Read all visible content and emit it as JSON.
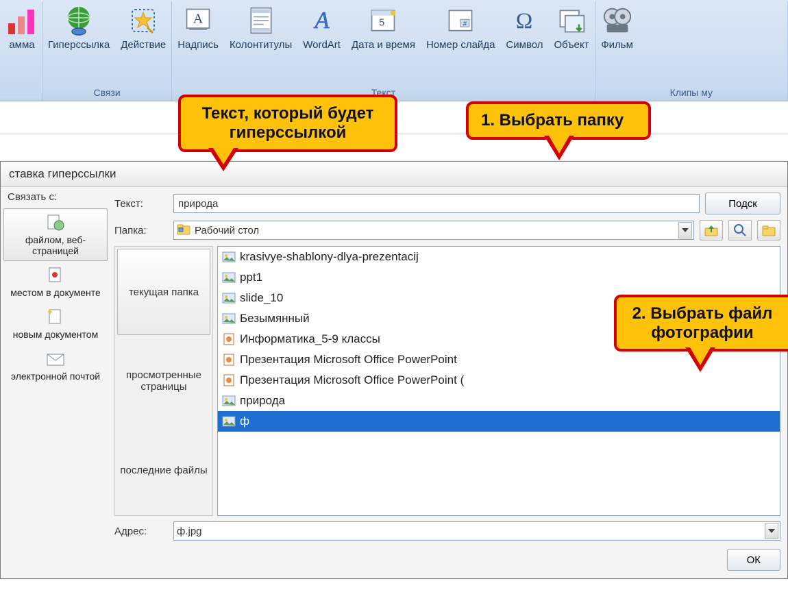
{
  "ribbon": {
    "groups": [
      {
        "label": "",
        "items": [
          {
            "label": "амма",
            "icon": "chart"
          }
        ]
      },
      {
        "label": "Связи",
        "items": [
          {
            "label": "Гиперссылка",
            "icon": "globe-link"
          },
          {
            "label": "Действие",
            "icon": "star-action"
          }
        ]
      },
      {
        "label": "Текст",
        "items": [
          {
            "label": "Надпись",
            "icon": "textbox-a"
          },
          {
            "label": "Колонтитулы",
            "icon": "header-footer"
          },
          {
            "label": "WordArt",
            "icon": "wordart-a"
          },
          {
            "label": "Дата и время",
            "icon": "date-time"
          },
          {
            "label": "Номер слайда",
            "icon": "slide-number"
          },
          {
            "label": "Символ",
            "icon": "omega"
          },
          {
            "label": "Объект",
            "icon": "object"
          }
        ]
      },
      {
        "label": "Клипы му",
        "items": [
          {
            "label": "Фильм",
            "icon": "film"
          }
        ]
      }
    ]
  },
  "dialog": {
    "title": "ставка гиперссылки",
    "link_to_label": "Связать с:",
    "text_label": "Текст:",
    "text_value": "природа",
    "folder_label": "Папка:",
    "folder_value": "Рабочий стол",
    "address_label": "Адрес:",
    "address_value": "ф.jpg",
    "hint_button": "Подск",
    "ok_button": "ОК",
    "left_items": [
      {
        "label": "файлом, веб-страницей",
        "icon": "file-web",
        "selected": true
      },
      {
        "label": "местом в документе",
        "icon": "place-doc",
        "selected": false
      },
      {
        "label": "новым документом",
        "icon": "new-doc",
        "selected": false
      },
      {
        "label": "электронной почтой",
        "icon": "email",
        "selected": false
      }
    ],
    "mid_tabs": [
      {
        "label": "текущая папка",
        "selected": true
      },
      {
        "label": "просмотрен­ные страницы",
        "selected": false
      },
      {
        "label": "последние файлы",
        "selected": false
      }
    ],
    "files": [
      {
        "name": "krasivye-shablony-dlya-prezentacij",
        "icon": "image",
        "selected": false
      },
      {
        "name": "ppt1",
        "icon": "image",
        "selected": false
      },
      {
        "name": "slide_10",
        "icon": "image",
        "selected": false
      },
      {
        "name": "Безымянный",
        "icon": "image",
        "selected": false
      },
      {
        "name": "Информатика_5-9 классы",
        "icon": "ppt",
        "selected": false
      },
      {
        "name": "Презентация Microsoft Office PowerPoint",
        "icon": "ppt",
        "selected": false
      },
      {
        "name": "Презентация Microsoft Office PowerPoint (",
        "icon": "ppt",
        "selected": false
      },
      {
        "name": "природа",
        "icon": "image",
        "selected": false
      },
      {
        "name": "ф",
        "icon": "image",
        "selected": true
      }
    ]
  },
  "callouts": {
    "c1": "Текст, который будет гиперссылкой",
    "c2": "1. Выбрать папку",
    "c3": "2. Выбрать файл фотографии"
  }
}
